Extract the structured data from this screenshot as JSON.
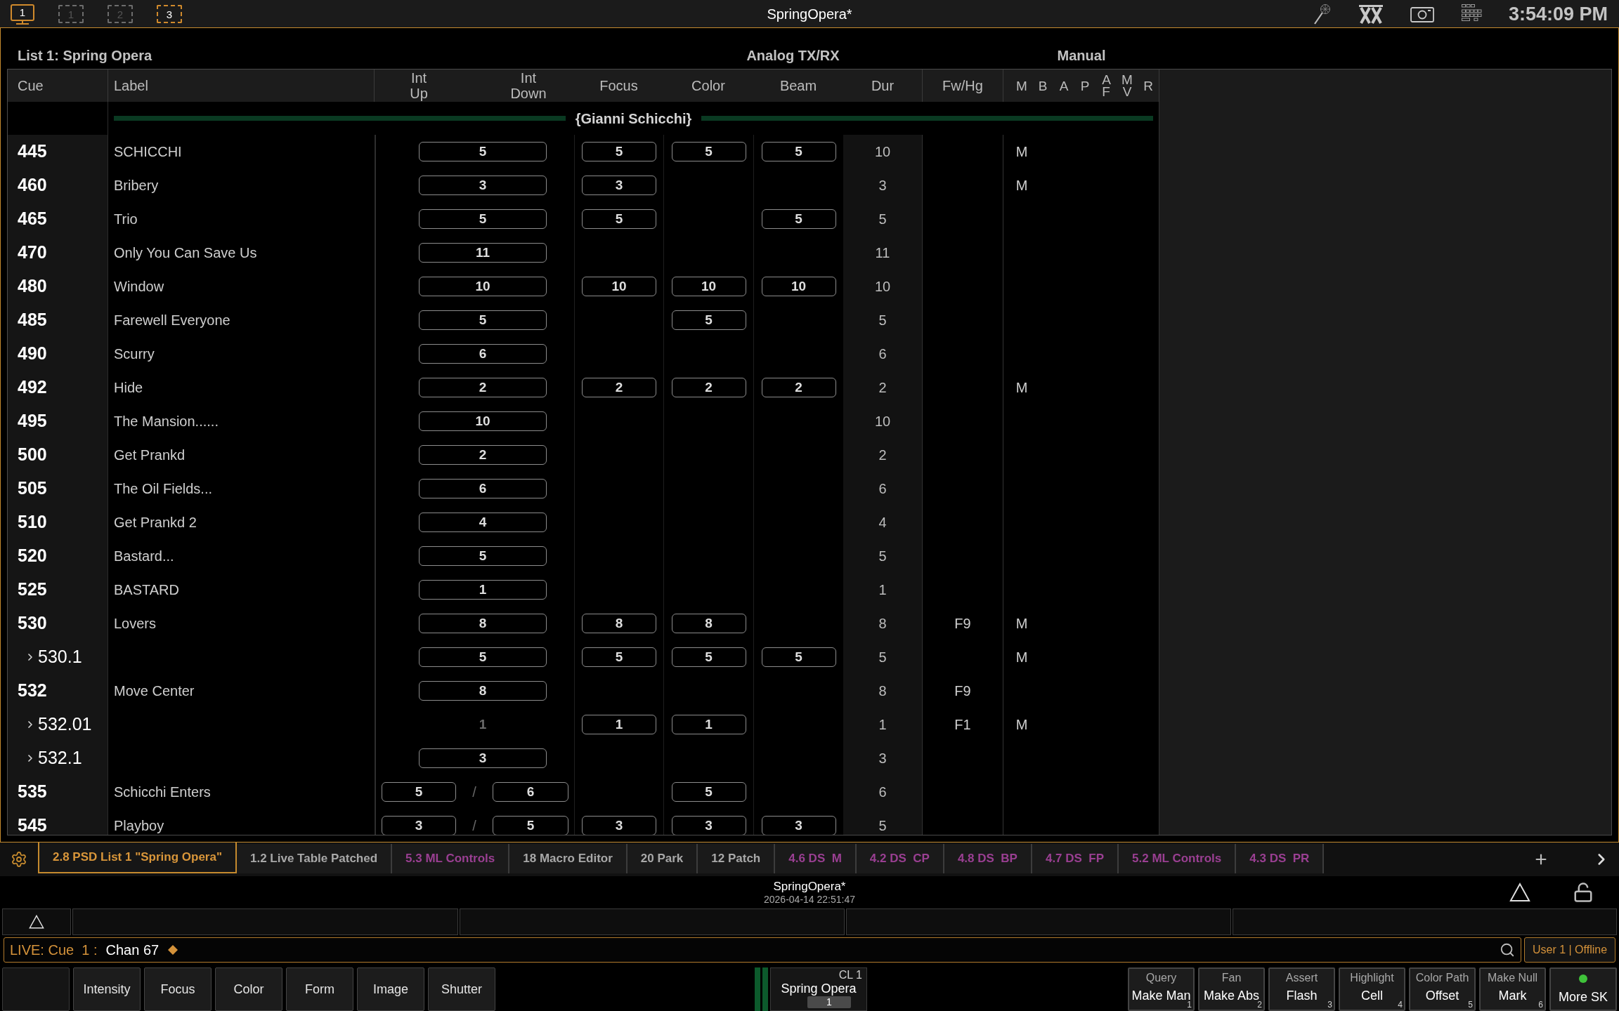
{
  "top_bar": {
    "screens": [
      {
        "label": "1",
        "kind": "monitor",
        "active": true
      },
      {
        "label": "1",
        "kind": "frame",
        "active": false
      },
      {
        "label": "2",
        "kind": "frame",
        "active": false
      },
      {
        "label": "3",
        "kind": "frame",
        "active": true
      }
    ],
    "title": "SpringOpera*",
    "clock": "3:54:09 PM"
  },
  "cue_list": {
    "title": "List 1: Spring Opera",
    "timing_group": "Analog TX/RX",
    "manual_group": "Manual",
    "columns": [
      "Cue",
      "Label",
      "Int Up",
      "Int Down",
      "Focus",
      "Color",
      "Beam",
      "Dur",
      "Fw/Hg"
    ],
    "manual_columns": [
      "M",
      "B",
      "A",
      "P",
      "A F",
      "M V",
      "R"
    ],
    "section": "{Gianni Schicchi}",
    "rows": [
      {
        "cue": "445",
        "kind": "cue",
        "label": "SCHICCHI",
        "int": "5",
        "int_boxed": true,
        "focus_time": "5",
        "color_time": "5",
        "beam_time": "5",
        "dur": "10",
        "manual_m": "M"
      },
      {
        "cue": "460",
        "kind": "cue",
        "label": "Bribery",
        "int": "3",
        "int_boxed": true,
        "focus_time": "3",
        "dur": "3",
        "manual_m": "M"
      },
      {
        "cue": "465",
        "kind": "cue",
        "label": "Trio",
        "int": "5",
        "int_boxed": true,
        "focus_time": "5",
        "beam_time": "5",
        "dur": "5"
      },
      {
        "cue": "470",
        "kind": "cue",
        "label": "Only You Can Save Us",
        "int": "11",
        "int_boxed": true,
        "dur": "11"
      },
      {
        "cue": "480",
        "kind": "cue",
        "label": "Window",
        "int": "10",
        "int_boxed": true,
        "focus_time": "10",
        "color_time": "10",
        "beam_time": "10",
        "dur": "10"
      },
      {
        "cue": "485",
        "kind": "cue",
        "label": "Farewell Everyone",
        "int": "5",
        "int_boxed": true,
        "color_time": "5",
        "dur": "5"
      },
      {
        "cue": "490",
        "kind": "cue",
        "label": "Scurry",
        "int": "6",
        "int_boxed": true,
        "dur": "6"
      },
      {
        "cue": "492",
        "kind": "cue",
        "label": "Hide",
        "int": "2",
        "int_boxed": true,
        "focus_time": "2",
        "color_time": "2",
        "beam_time": "2",
        "dur": "2",
        "manual_m": "M"
      },
      {
        "cue": "495",
        "kind": "cue",
        "label": "The Mansion......",
        "int": "10",
        "int_boxed": true,
        "dur": "10"
      },
      {
        "cue": "500",
        "kind": "cue",
        "label": "Get Prankd",
        "int": "2",
        "int_boxed": true,
        "dur": "2"
      },
      {
        "cue": "505",
        "kind": "cue",
        "label": "The Oil Fields...",
        "int": "6",
        "int_boxed": true,
        "dur": "6"
      },
      {
        "cue": "510",
        "kind": "cue",
        "label": "Get Prankd 2",
        "int": "4",
        "int_boxed": true,
        "dur": "4"
      },
      {
        "cue": "520",
        "kind": "cue",
        "label": "Bastard...",
        "int": "5",
        "int_boxed": true,
        "dur": "5"
      },
      {
        "cue": "525",
        "kind": "cue",
        "label": "BASTARD",
        "int": "1",
        "int_boxed": true,
        "dur": "1"
      },
      {
        "cue": "530",
        "kind": "cue",
        "label": "Lovers",
        "int": "8",
        "int_boxed": true,
        "focus_time": "8",
        "color_time": "8",
        "dur": "8",
        "fw_hg": "F9",
        "manual_m": "M"
      },
      {
        "cue": "530.1",
        "kind": "part",
        "int": "5",
        "int_boxed": true,
        "focus_time": "5",
        "color_time": "5",
        "beam_time": "5",
        "dur": "5",
        "manual_m": "M"
      },
      {
        "cue": "532",
        "kind": "cue",
        "label": "Move Center",
        "int": "8",
        "int_boxed": true,
        "dur": "8",
        "fw_hg": "F9"
      },
      {
        "cue": "532.01",
        "kind": "part",
        "int": "1",
        "int_boxed": false,
        "focus_time": "1",
        "color_time": "1",
        "dur": "1",
        "fw_hg": "F1",
        "manual_m": "M"
      },
      {
        "cue": "532.1",
        "kind": "part",
        "int": "3",
        "int_boxed": true,
        "dur": "3"
      },
      {
        "cue": "535",
        "kind": "cue",
        "label": "Schicchi Enters",
        "int_up": "5",
        "int_sep": "/",
        "int_down": "6",
        "int_boxed": true,
        "color_time": "5",
        "dur": "6"
      },
      {
        "cue": "545",
        "kind": "cue",
        "label": "Playboy",
        "int_up": "3",
        "int_sep": "/",
        "int_down": "5",
        "int_boxed": true,
        "focus_time": "3",
        "color_time": "3",
        "beam_time": "3",
        "dur": "5"
      }
    ]
  },
  "tabs": [
    {
      "label": "2.8 PSD List 1 \"Spring Opera\"",
      "selected": true,
      "color": "#d9963a"
    },
    {
      "label": "1.2 Live Table Patched",
      "selected": false,
      "color": "#a8a8a8"
    },
    {
      "label": "5.3 ML Controls",
      "selected": false,
      "color": "#9a3f92"
    },
    {
      "label": "18 Macro Editor",
      "selected": false,
      "color": "#a8a8a8"
    },
    {
      "label": "20 Park",
      "selected": false,
      "color": "#a8a8a8"
    },
    {
      "label": "12 Patch",
      "selected": false,
      "color": "#a8a8a8"
    },
    {
      "label": "4.6 DS  M",
      "selected": false,
      "color": "#9a3f92"
    },
    {
      "label": "4.2 DS  CP",
      "selected": false,
      "color": "#9a3f92"
    },
    {
      "label": "4.8 DS  BP",
      "selected": false,
      "color": "#9a3f92"
    },
    {
      "label": "4.7 DS  FP",
      "selected": false,
      "color": "#9a3f92"
    },
    {
      "label": "5.2 ML Controls",
      "selected": false,
      "color": "#9a3f92"
    },
    {
      "label": "4.3 DS  PR",
      "selected": false,
      "color": "#9a3f92"
    }
  ],
  "show": {
    "name": "SpringOpera*",
    "saved": "2026-04-14 22:51:47"
  },
  "command_line": {
    "prompt": "LIVE: Cue  1 :",
    "text": "Chan 67",
    "user": "User 1 | Offline"
  },
  "category_keys": [
    "Intensity",
    "Focus",
    "Color",
    "Form",
    "Image",
    "Shutter"
  ],
  "fader": {
    "label": "CL 1",
    "name": "Spring Opera",
    "value": "1"
  },
  "softkeys": [
    {
      "kind": "key",
      "top": "Query",
      "label": "Make Man",
      "index": "1"
    },
    {
      "kind": "key",
      "top": "Fan",
      "label": "Make Abs",
      "index": "2"
    },
    {
      "kind": "key",
      "top": "Assert",
      "label": "Flash",
      "index": "3"
    },
    {
      "kind": "key",
      "top": "Highlight",
      "label": "Cell",
      "index": "4"
    },
    {
      "kind": "key",
      "top": "Color Path",
      "label": "Offset",
      "index": "5"
    },
    {
      "kind": "key",
      "top": "Make Null",
      "label": "Mark",
      "index": "6"
    },
    {
      "kind": "page",
      "label": "More SK"
    }
  ]
}
